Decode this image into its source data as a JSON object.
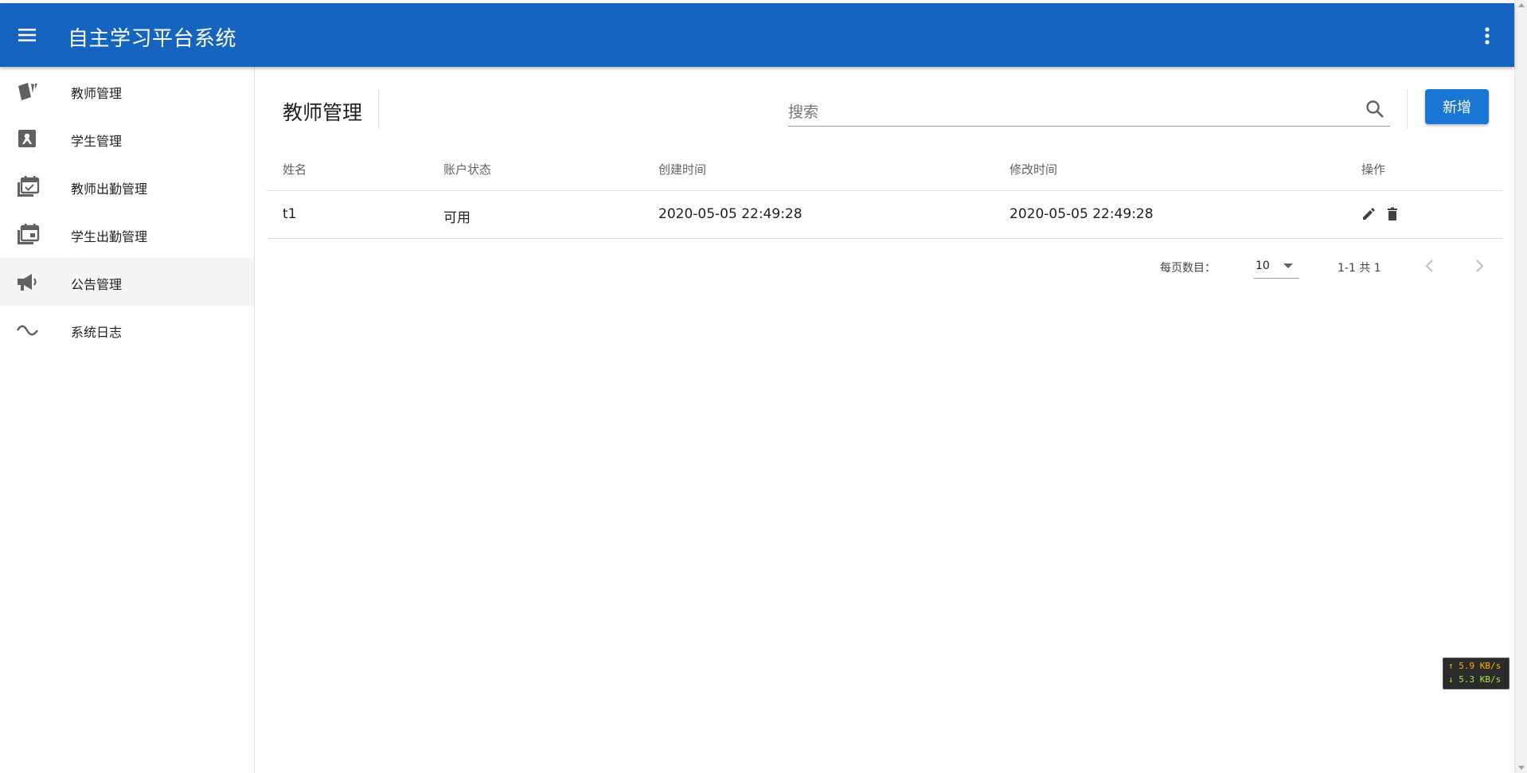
{
  "app": {
    "title": "自主学习平台系统"
  },
  "sidebar": {
    "items": [
      {
        "label": "教师管理",
        "icon": "cards-icon"
      },
      {
        "label": "学生管理",
        "icon": "account-box-icon"
      },
      {
        "label": "教师出勤管理",
        "icon": "calendar-check-icon"
      },
      {
        "label": "学生出勤管理",
        "icon": "calendar-stack-icon"
      },
      {
        "label": "公告管理",
        "icon": "megaphone-icon",
        "active": true
      },
      {
        "label": "系统日志",
        "icon": "wave-icon"
      }
    ]
  },
  "page": {
    "title": "教师管理",
    "search_placeholder": "搜索",
    "add_label": "新增"
  },
  "table": {
    "columns": [
      "姓名",
      "账户状态",
      "创建时间",
      "修改时间",
      "操作"
    ],
    "rows": [
      {
        "name": "t1",
        "status": "可用",
        "created": "2020-05-05 22:49:28",
        "modified": "2020-05-05 22:49:28"
      }
    ]
  },
  "pagination": {
    "per_page_label": "每页数目：",
    "per_page_value": "10",
    "range_text": "1-1 共 1"
  },
  "netspeed": {
    "up": "↑ 5.9 KB/s",
    "down": "↓ 5.3 KB/s"
  },
  "colors": {
    "appbar": "#1565c0",
    "primary_button": "#1976d2"
  }
}
